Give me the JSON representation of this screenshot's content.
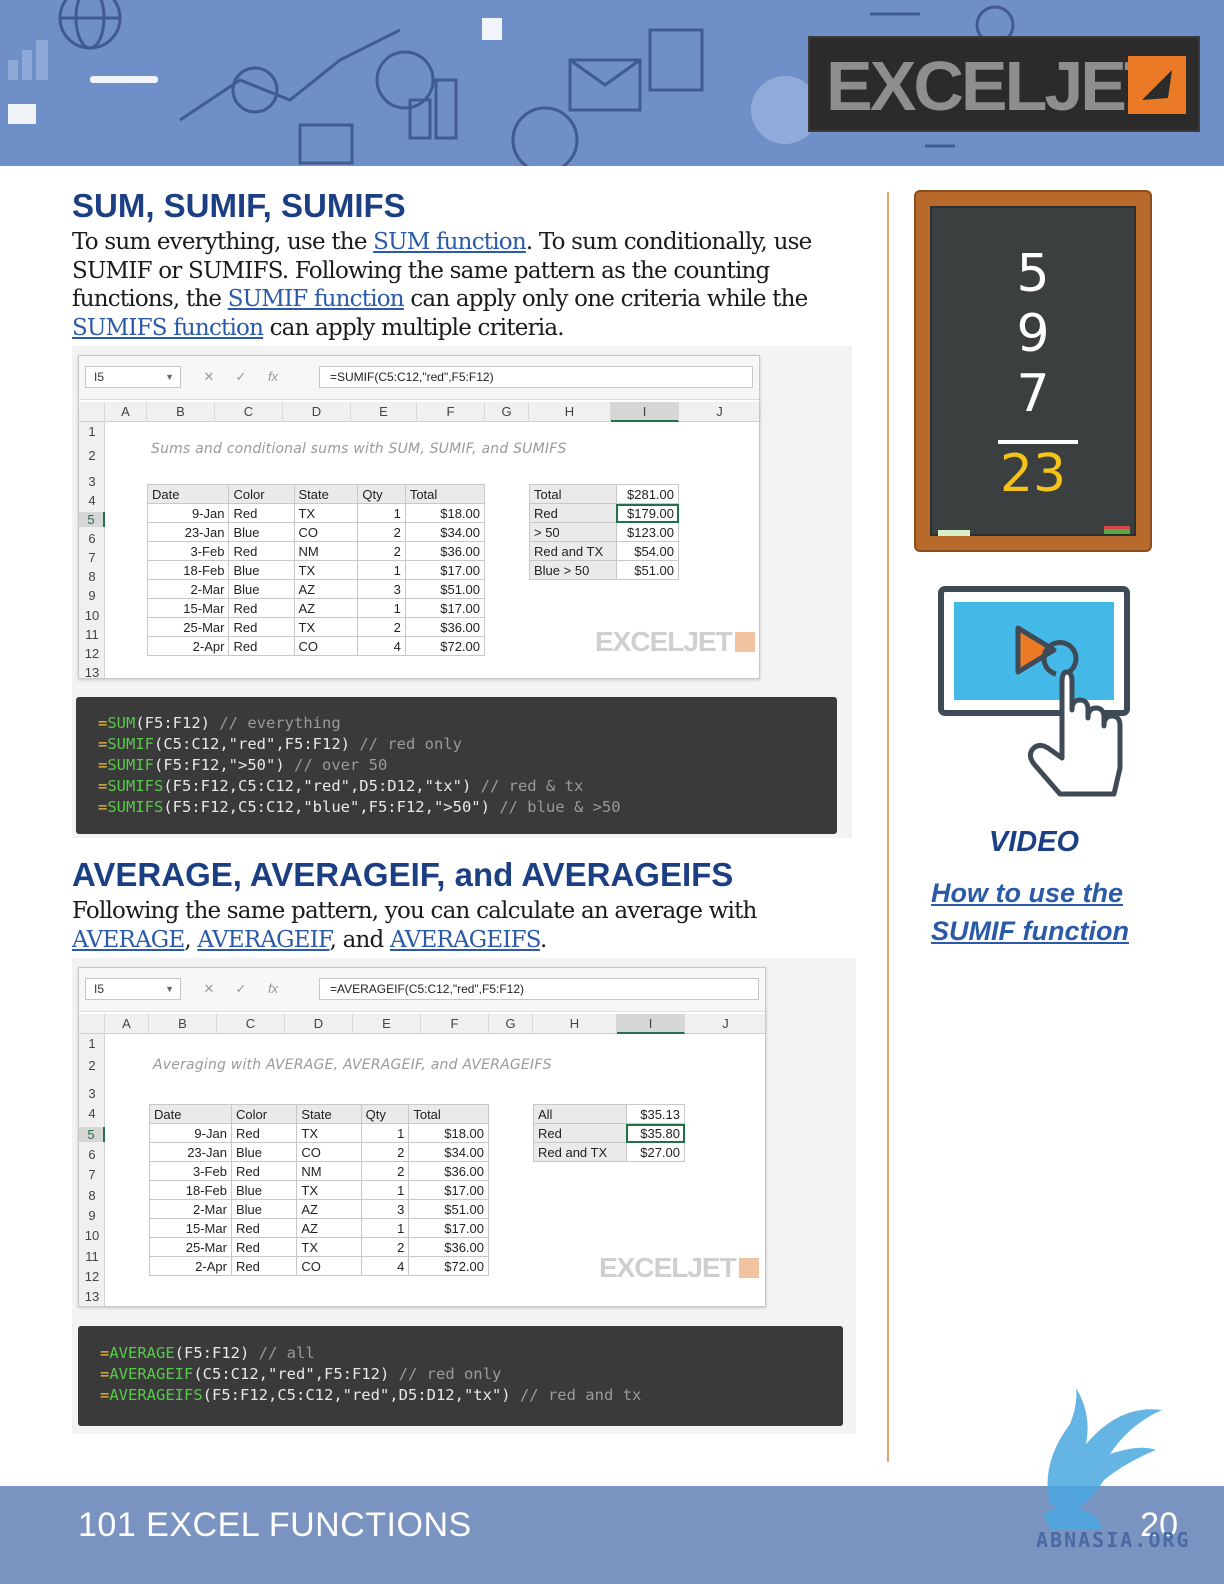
{
  "header": {
    "logo_text": "EXCELJET",
    "colors": {
      "banner": "#6f8fc9",
      "logo_bg": "#2b2b2b",
      "accent": "#ea7a26"
    }
  },
  "section1": {
    "title": "SUM, SUMIF, SUMIFS",
    "p_part1": "To sum everything, use the ",
    "link_sum": "SUM function",
    "p_part2": ". To sum conditionally, use SUMIF or SUMIFS. Following the same pattern as the counting functions, the ",
    "link_sumif": "SUMIF function",
    "p_part3": " can apply only one criteria while the ",
    "link_sumifs": "SUMIFS function",
    "p_part4": " can apply multiple criteria."
  },
  "sheet1": {
    "namebox": "I5",
    "formula": "=SUMIF(C5:C12,\"red\",F5:F12)",
    "columns": [
      "A",
      "B",
      "C",
      "D",
      "E",
      "F",
      "G",
      "H",
      "I",
      "J"
    ],
    "rows": [
      "1",
      "2",
      "3",
      "4",
      "5",
      "6",
      "7",
      "8",
      "9",
      "10",
      "11",
      "12",
      "13"
    ],
    "title": "Sums and conditional sums with SUM, SUMIF, and SUMIFS",
    "headers": [
      "Date",
      "Color",
      "State",
      "Qty",
      "Total"
    ],
    "data": [
      [
        "9-Jan",
        "Red",
        "TX",
        "1",
        "$18.00"
      ],
      [
        "23-Jan",
        "Blue",
        "CO",
        "2",
        "$34.00"
      ],
      [
        "3-Feb",
        "Red",
        "NM",
        "2",
        "$36.00"
      ],
      [
        "18-Feb",
        "Blue",
        "TX",
        "1",
        "$17.00"
      ],
      [
        "2-Mar",
        "Blue",
        "AZ",
        "3",
        "$51.00"
      ],
      [
        "15-Mar",
        "Red",
        "AZ",
        "1",
        "$17.00"
      ],
      [
        "25-Mar",
        "Red",
        "TX",
        "2",
        "$36.00"
      ],
      [
        "2-Apr",
        "Red",
        "CO",
        "4",
        "$72.00"
      ]
    ],
    "summary": [
      [
        "Total",
        "$281.00"
      ],
      [
        "Red",
        "$179.00"
      ],
      [
        "> 50",
        "$123.00"
      ],
      [
        "Red and TX",
        "$54.00"
      ],
      [
        "Blue > 50",
        "$51.00"
      ]
    ],
    "watermark": "EXCELJET"
  },
  "code1": [
    {
      "fn": "SUM",
      "args": "(F5:F12)",
      "comment": "// everything"
    },
    {
      "fn": "SUMIF",
      "args": "(C5:C12,\"red\",F5:F12)",
      "comment": "// red only"
    },
    {
      "fn": "SUMIF",
      "args": "(F5:F12,\">50\")",
      "comment": "// over 50"
    },
    {
      "fn": "SUMIFS",
      "args": "(F5:F12,C5:C12,\"red\",D5:D12,\"tx\")",
      "comment": "// red & tx"
    },
    {
      "fn": "SUMIFS",
      "args": "(F5:F12,C5:C12,\"blue\",F5:F12,\">50\")",
      "comment": "// blue & >50"
    }
  ],
  "section2": {
    "title": "AVERAGE, AVERAGEIF, and AVERAGEIFS",
    "p_part1": "Following the same pattern, you can calculate an average with ",
    "link_average": "AVERAGE",
    "p_part2": ", ",
    "link_averageif": "AVERAGEIF",
    "p_part3": ", and ",
    "link_averageifs": "AVERAGEIFS",
    "p_part4": "."
  },
  "sheet2": {
    "namebox": "I5",
    "formula": "=AVERAGEIF(C5:C12,\"red\",F5:F12)",
    "title": "Averaging with AVERAGE, AVERAGEIF, and AVERAGEIFS",
    "headers": [
      "Date",
      "Color",
      "State",
      "Qty",
      "Total"
    ],
    "data": [
      [
        "9-Jan",
        "Red",
        "TX",
        "1",
        "$18.00"
      ],
      [
        "23-Jan",
        "Blue",
        "CO",
        "2",
        "$34.00"
      ],
      [
        "3-Feb",
        "Red",
        "NM",
        "2",
        "$36.00"
      ],
      [
        "18-Feb",
        "Blue",
        "TX",
        "1",
        "$17.00"
      ],
      [
        "2-Mar",
        "Blue",
        "AZ",
        "3",
        "$51.00"
      ],
      [
        "15-Mar",
        "Red",
        "AZ",
        "1",
        "$17.00"
      ],
      [
        "25-Mar",
        "Red",
        "TX",
        "2",
        "$36.00"
      ],
      [
        "2-Apr",
        "Red",
        "CO",
        "4",
        "$72.00"
      ]
    ],
    "summary": [
      [
        "All",
        "$35.13"
      ],
      [
        "Red",
        "$35.80"
      ],
      [
        "Red and TX",
        "$27.00"
      ]
    ],
    "watermark": "EXCELJET"
  },
  "code2": [
    {
      "fn": "AVERAGE",
      "args": "(F5:F12)",
      "comment": "// all"
    },
    {
      "fn": "AVERAGEIF",
      "args": "(C5:C12,\"red\",F5:F12)",
      "comment": "// red only"
    },
    {
      "fn": "AVERAGEIFS",
      "args": "(F5:F12,C5:C12,\"red\",D5:D12,\"tx\")",
      "comment": "// red and tx"
    }
  ],
  "sidebar": {
    "chalk_numbers": [
      "5",
      "9",
      "7"
    ],
    "chalk_sum": "23",
    "video_label": "VIDEO",
    "video_link_line1": "How to use the",
    "video_link_line2": "SUMIF function"
  },
  "footer": {
    "title": "101 EXCEL FUNCTIONS",
    "page": "20",
    "watermark": "ABNASIA.ORG"
  }
}
